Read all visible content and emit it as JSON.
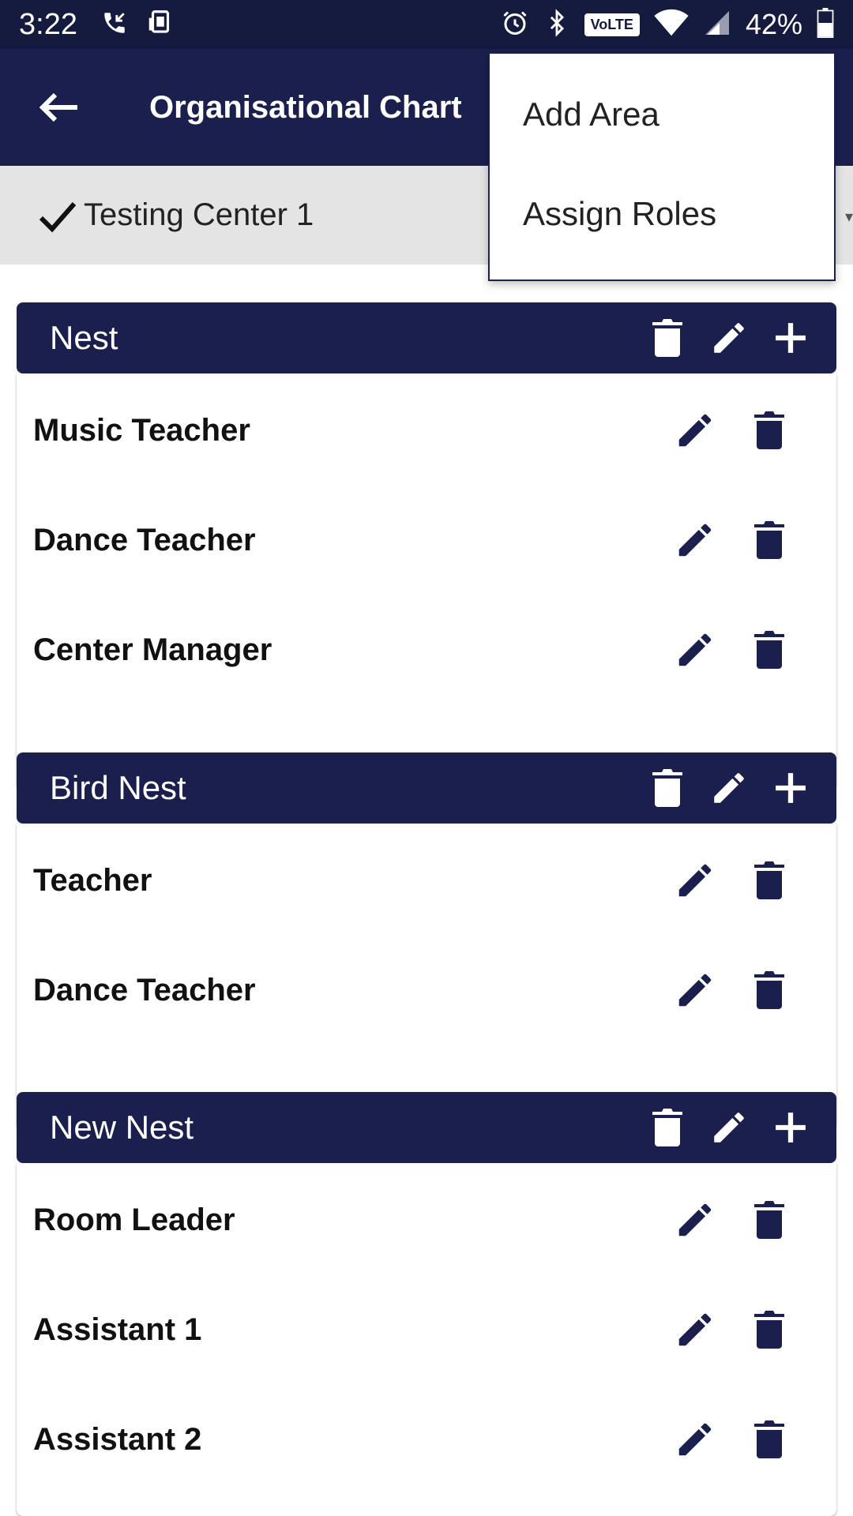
{
  "status_bar": {
    "time": "3:22",
    "battery": "42%",
    "volte": "VoLTE",
    "icons": [
      "missed-call-icon",
      "phone-sync-icon",
      "alarm-icon",
      "bluetooth-icon",
      "volte-icon",
      "wifi-icon",
      "signal-icon",
      "battery-icon"
    ]
  },
  "app_bar": {
    "title": "Organisational Chart"
  },
  "center": {
    "label": "Testing Center 1"
  },
  "menu": {
    "items": [
      {
        "label": "Add Area"
      },
      {
        "label": "Assign Roles"
      }
    ]
  },
  "areas": [
    {
      "name": "Nest",
      "roles": [
        {
          "name": "Music Teacher"
        },
        {
          "name": "Dance Teacher"
        },
        {
          "name": "Center Manager"
        }
      ]
    },
    {
      "name": "Bird Nest",
      "roles": [
        {
          "name": "Teacher"
        },
        {
          "name": "Dance Teacher"
        }
      ]
    },
    {
      "name": "New Nest",
      "roles": [
        {
          "name": "Room Leader"
        },
        {
          "name": "Assistant 1"
        },
        {
          "name": "Assistant 2"
        }
      ]
    }
  ],
  "colors": {
    "primary": "#1a1f4e",
    "status_bar": "#151a3f",
    "selector_bg": "#e4e4e4"
  }
}
